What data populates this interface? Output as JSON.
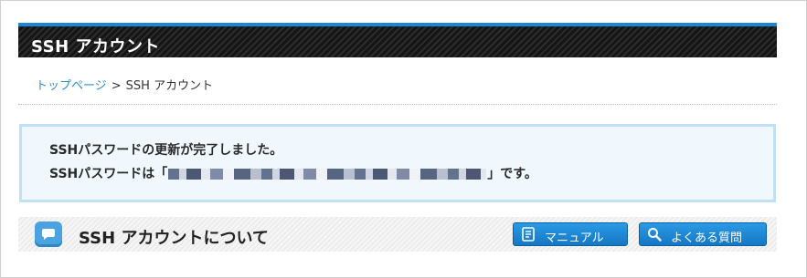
{
  "header": {
    "title": "SSH アカウント"
  },
  "breadcrumb": {
    "home_link": "トップページ",
    "separator": ">",
    "current": "SSH アカウント"
  },
  "message": {
    "line1": "SSHパスワードの更新が完了しました。",
    "line2_prefix": "SSHパスワードは「",
    "line2_suffix": "」です。"
  },
  "section": {
    "title": "SSH アカウントについて",
    "icon": "speech-bubble-icon",
    "buttons": {
      "manual_label": "マニュアル",
      "manual_icon": "manual-book-icon",
      "faq_label": "よくある質問",
      "faq_icon": "search-icon"
    }
  },
  "colors": {
    "header_accent": "#1e86d6",
    "link": "#2a8fd0",
    "button": "#1c85d6",
    "message_border": "#bfe0f5"
  }
}
